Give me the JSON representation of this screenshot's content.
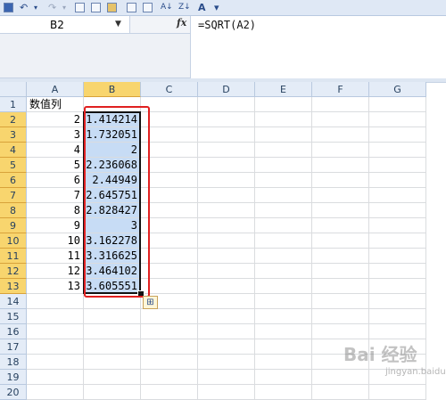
{
  "toolbar": {
    "icons": [
      "save-icon",
      "undo-icon",
      "redo-icon",
      "insert-table-icon",
      "form-icon",
      "chart-icon",
      "print-icon",
      "print-preview-icon",
      "sort-ascending-icon",
      "sort-descending-icon",
      "font-size-icon",
      "more-icon"
    ],
    "undo_glyph": "↶",
    "redo_glyph": "↷",
    "font_glyph": "A",
    "more_glyph": "▾"
  },
  "formula_bar": {
    "name_box": "B2",
    "fx_label": "fx",
    "formula": "=SQRT(A2)"
  },
  "columns": [
    "A",
    "B",
    "C",
    "D",
    "E",
    "F",
    "G"
  ],
  "selected_column": "B",
  "rows": [
    {
      "num": "1",
      "a": "数值列",
      "b": "",
      "sel": false
    },
    {
      "num": "2",
      "a": "2",
      "b": "1.414214",
      "sel": true
    },
    {
      "num": "3",
      "a": "3",
      "b": "1.732051",
      "sel": true
    },
    {
      "num": "4",
      "a": "4",
      "b": "2",
      "sel": true
    },
    {
      "num": "5",
      "a": "5",
      "b": "2.236068",
      "sel": true
    },
    {
      "num": "6",
      "a": "6",
      "b": "2.44949",
      "sel": true
    },
    {
      "num": "7",
      "a": "7",
      "b": "2.645751",
      "sel": true
    },
    {
      "num": "8",
      "a": "8",
      "b": "2.828427",
      "sel": true
    },
    {
      "num": "9",
      "a": "9",
      "b": "3",
      "sel": true
    },
    {
      "num": "10",
      "a": "10",
      "b": "3.162278",
      "sel": true
    },
    {
      "num": "11",
      "a": "11",
      "b": "3.316625",
      "sel": true
    },
    {
      "num": "12",
      "a": "12",
      "b": "3.464102",
      "sel": true
    },
    {
      "num": "13",
      "a": "13",
      "b": "3.605551",
      "sel": true
    },
    {
      "num": "14",
      "a": "",
      "b": "",
      "sel": false
    },
    {
      "num": "15",
      "a": "",
      "b": "",
      "sel": false
    },
    {
      "num": "16",
      "a": "",
      "b": "",
      "sel": false
    },
    {
      "num": "17",
      "a": "",
      "b": "",
      "sel": false
    },
    {
      "num": "18",
      "a": "",
      "b": "",
      "sel": false
    },
    {
      "num": "19",
      "a": "",
      "b": "",
      "sel": false
    },
    {
      "num": "20",
      "a": "",
      "b": "",
      "sel": false
    }
  ],
  "watermark": {
    "main": "Bai 经验",
    "sub": "jingyan.baidu.com"
  },
  "colors": {
    "selection_fill": "#c7dcf5",
    "header_selected": "#f8d56e",
    "annotation_red": "#e02020"
  }
}
